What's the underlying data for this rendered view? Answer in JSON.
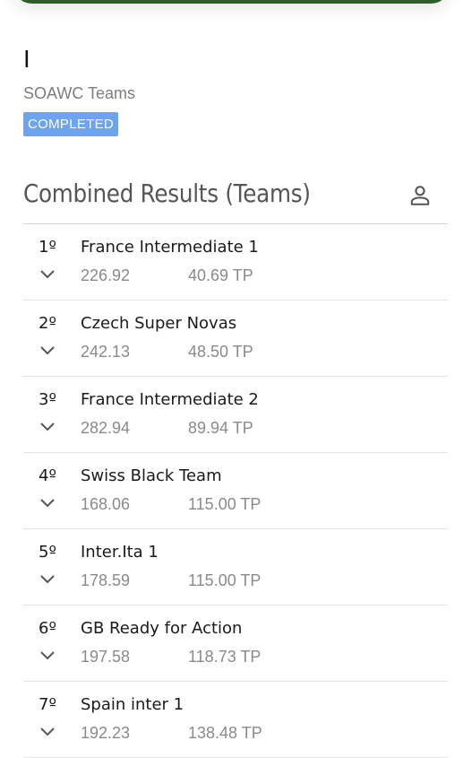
{
  "event": {
    "title": "I",
    "subtitle": "SOAWC Teams",
    "status": "COMPLETED"
  },
  "section": {
    "title": "Combined Results (Teams)",
    "icon": "person-icon"
  },
  "results": [
    {
      "rank": "1º",
      "team": "France Intermediate 1",
      "score": "226.92",
      "tp": "40.69 TP"
    },
    {
      "rank": "2º",
      "team": "Czech Super Novas",
      "score": "242.13",
      "tp": "48.50 TP"
    },
    {
      "rank": "3º",
      "team": "France Intermediate 2",
      "score": "282.94",
      "tp": "89.94 TP"
    },
    {
      "rank": "4º",
      "team": "Swiss Black Team",
      "score": "168.06",
      "tp": "115.00 TP"
    },
    {
      "rank": "5º",
      "team": "Inter.Ita 1",
      "score": "178.59",
      "tp": "115.00 TP"
    },
    {
      "rank": "6º",
      "team": "GB Ready for Action",
      "score": "197.58",
      "tp": "118.73 TP"
    },
    {
      "rank": "7º",
      "team": "Spain inter 1",
      "score": "192.23",
      "tp": "138.48 TP"
    }
  ],
  "colors": {
    "header_bar": "#2f5d2a",
    "badge": "#6ea3ee"
  }
}
